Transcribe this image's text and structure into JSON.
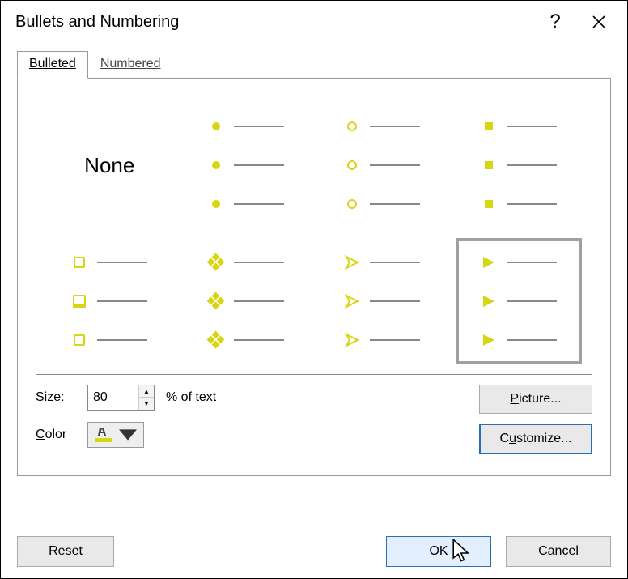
{
  "titlebar": {
    "title": "Bullets and Numbering",
    "help_label": "?"
  },
  "tabs": {
    "bulleted": "Bulleted",
    "numbered": "Numbered",
    "active": "bulleted"
  },
  "grid": {
    "none_label": "None",
    "selected_index": 7
  },
  "size": {
    "label": "Size:",
    "value": "80",
    "suffix": "% of text"
  },
  "color": {
    "label": "Color",
    "value": "#d8d512"
  },
  "buttons": {
    "picture": "Picture...",
    "customize": "Customize...",
    "reset": "Reset",
    "ok": "OK",
    "cancel": "Cancel"
  }
}
